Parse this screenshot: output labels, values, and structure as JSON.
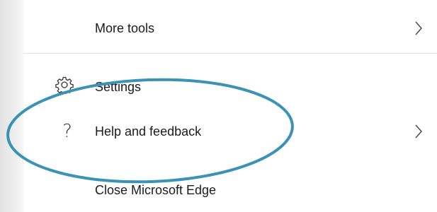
{
  "menu": {
    "items": [
      {
        "label": "More tools",
        "icon": "",
        "has_submenu": true
      },
      {
        "label": "Settings",
        "icon": "gear-icon",
        "has_submenu": false
      },
      {
        "label": "Help and feedback",
        "icon": "question-icon",
        "icon_glyph": "?",
        "has_submenu": true
      },
      {
        "label": "Close Microsoft Edge",
        "icon": "",
        "has_submenu": false
      }
    ]
  },
  "annotation": {
    "shape": "ellipse",
    "color": "#3a93b5",
    "target": "Help and feedback"
  }
}
